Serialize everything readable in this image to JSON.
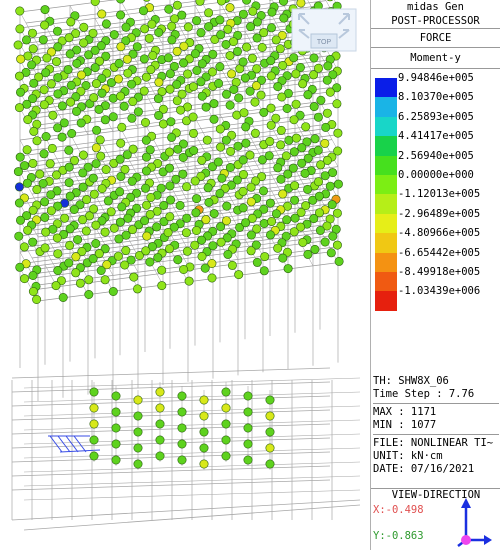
{
  "header": {
    "app": "midas Gen",
    "mode": "POST-PROCESSOR",
    "type": "FORCE",
    "component": "Moment-y"
  },
  "legend": [
    {
      "value": "9.94846e+005",
      "color": "#0a1ee8"
    },
    {
      "value": "8.10370e+005",
      "color": "#1ab4e6"
    },
    {
      "value": "6.25893e+005",
      "color": "#18d6c8"
    },
    {
      "value": "4.41417e+005",
      "color": "#18d24a"
    },
    {
      "value": "2.56940e+005",
      "color": "#46e01e"
    },
    {
      "value": "0.00000e+000",
      "color": "#7cee14"
    },
    {
      "value": "-1.12013e+005",
      "color": "#b6ee18"
    },
    {
      "value": "-2.96489e+005",
      "color": "#e6ee18"
    },
    {
      "value": "-4.80966e+005",
      "color": "#f0c814"
    },
    {
      "value": "-6.65442e+005",
      "color": "#f49212"
    },
    {
      "value": "-8.49918e+005",
      "color": "#f05a12"
    },
    {
      "value": "-1.03439e+006",
      "color": "#e6200e"
    }
  ],
  "info": {
    "th": "TH: SHW8X_06",
    "time_step": "Time Step : 7.76",
    "max": "MAX : 1171",
    "min": "MIN : 1077",
    "file": "FILE: NONLINEAR TI~",
    "unit": "UNIT: kN·cm",
    "date": "DATE: 07/16/2021"
  },
  "view_direction": {
    "title": "VIEW-DIRECTION",
    "x": "X:-0.498",
    "y": "Y:-0.863"
  },
  "navcube": {
    "label": "TOP"
  },
  "colors": {
    "ball_main": "#5ed21e",
    "ball_alt": "#8fe41a",
    "ball_yellow": "#d8e81a",
    "ball_blue": "#1430d8",
    "ball_orange": "#f09a14",
    "frame": "#9a9a9a",
    "base_frame": "#a8a8a8"
  }
}
